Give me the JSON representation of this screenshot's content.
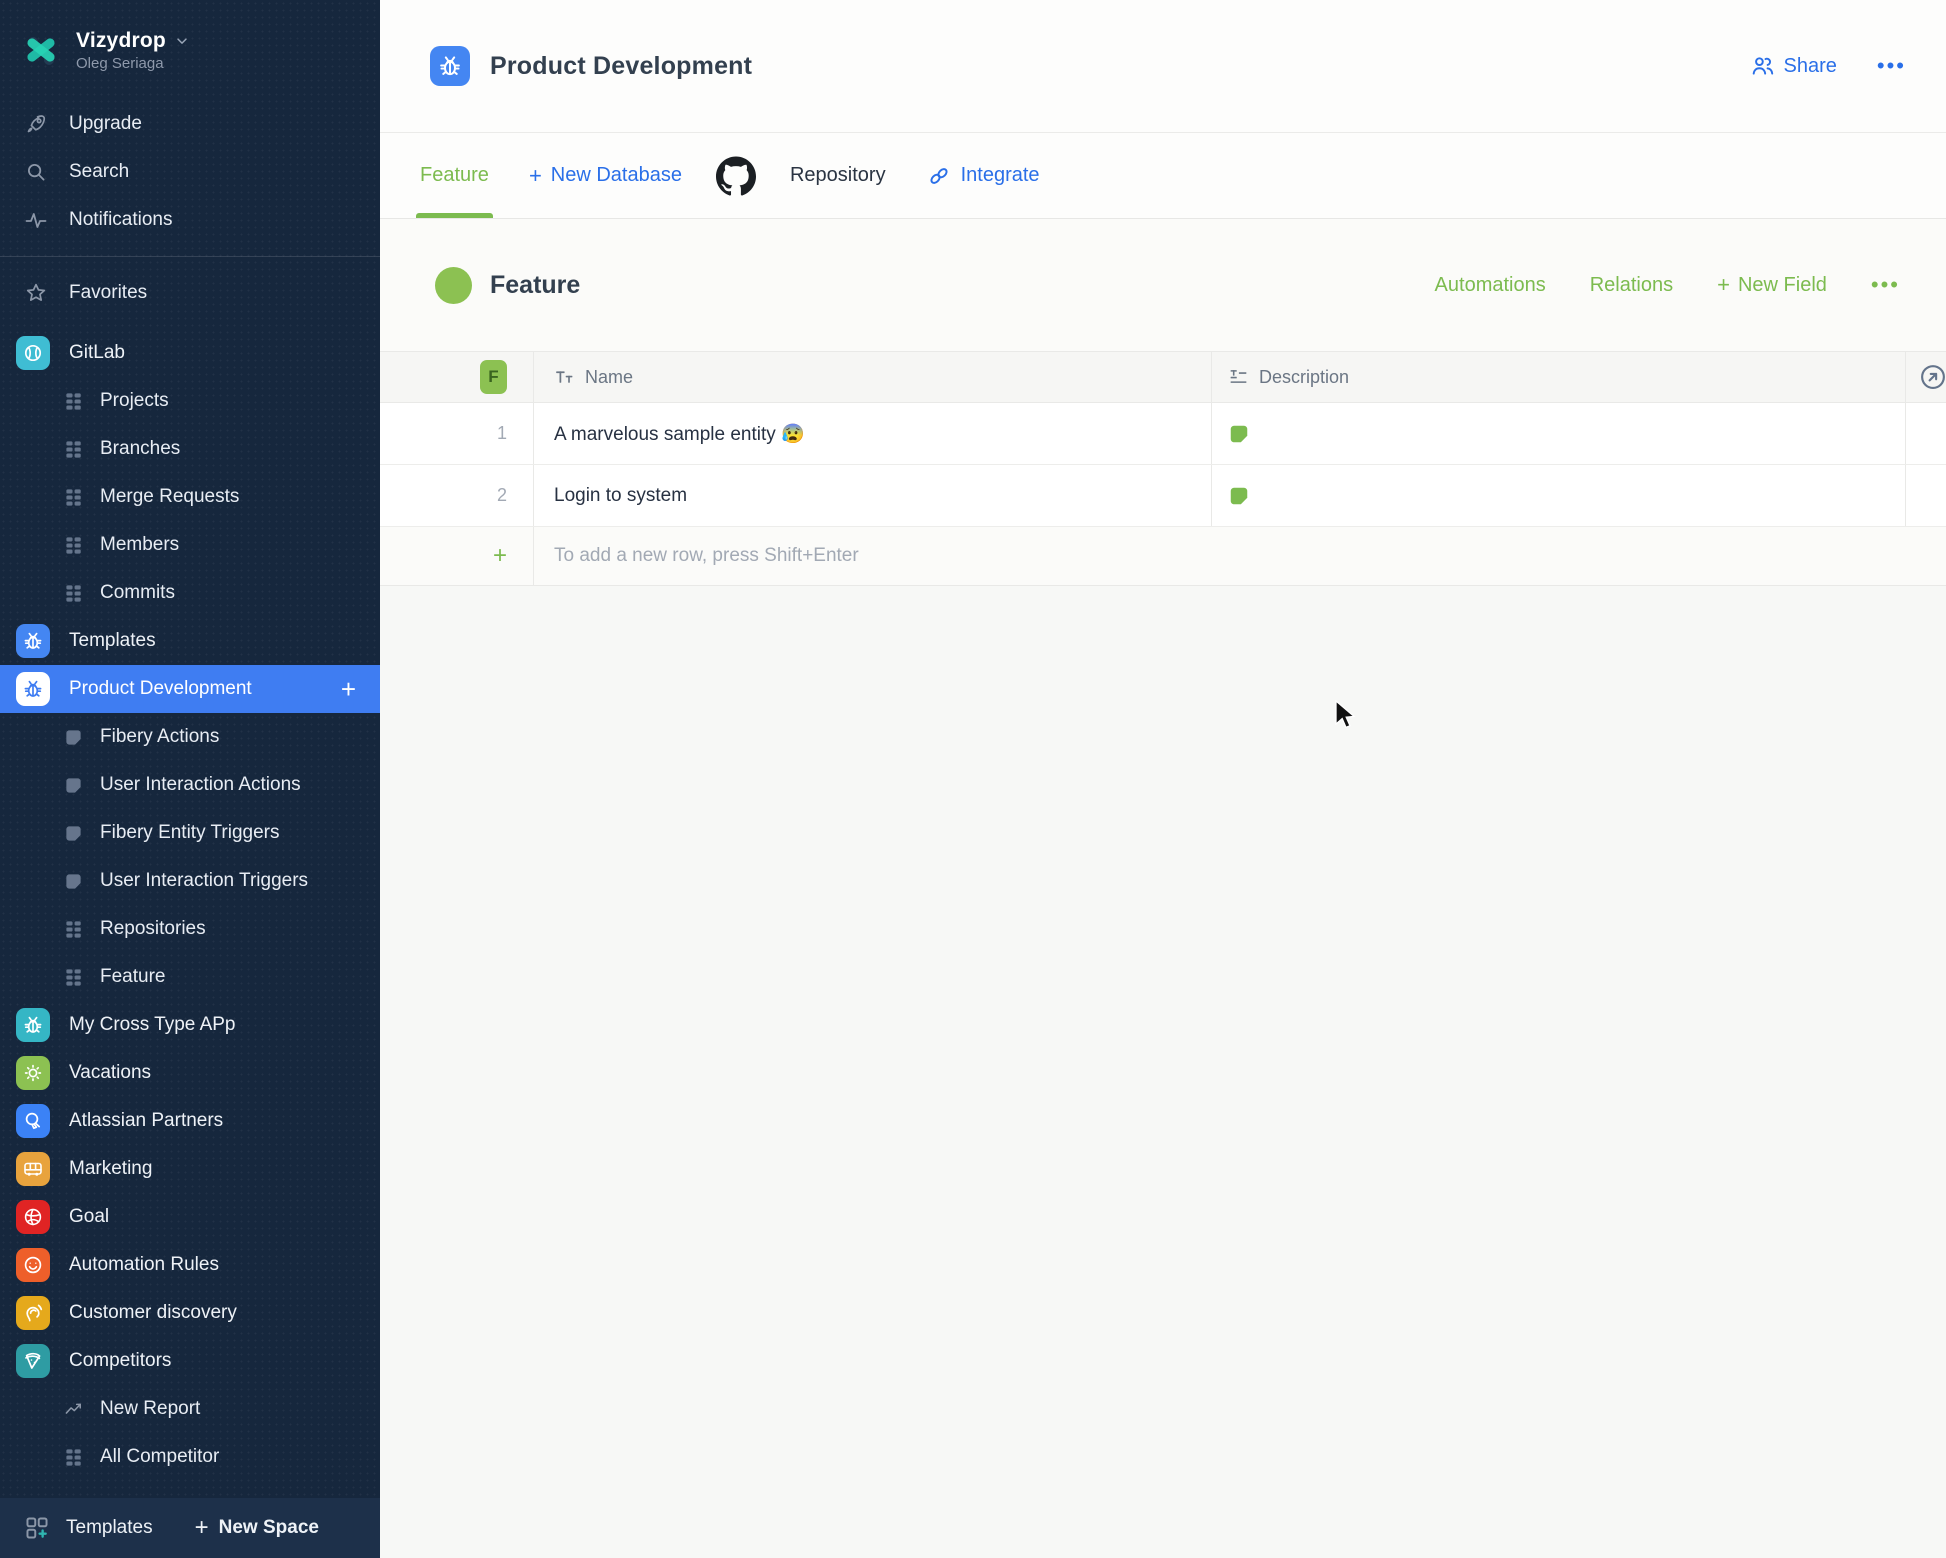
{
  "colors": {
    "sidebar_bg": "#16273d",
    "selected_blue": "#3f7df2",
    "accent_green": "#7cbb4f",
    "accent_blue": "#2a6fe8",
    "tile_blue": "#4486f2",
    "tile_teal": "#35b6c5",
    "tile_green": "#8cc152",
    "tile_amber": "#e8a33d",
    "tile_red": "#e02424",
    "tile_orange": "#ee5f2a",
    "tile_yellow": "#e5a91c",
    "tile_cyan": "#2e9ca3"
  },
  "sidebar": {
    "workspace_name": "Vizydrop",
    "workspace_user": "Oleg Seriaga",
    "upgrade": "Upgrade",
    "search": "Search",
    "notifications": "Notifications",
    "favorites": "Favorites",
    "gitlab": {
      "label": "GitLab",
      "children": [
        "Projects",
        "Branches",
        "Merge Requests",
        "Members",
        "Commits"
      ]
    },
    "templates_space": {
      "label": "Templates"
    },
    "product_development": {
      "label": "Product Development",
      "add_button": "+",
      "doc_children": [
        "Fibery Actions",
        "User Interaction Actions",
        "Fibery Entity Triggers",
        "User Interaction Triggers"
      ],
      "db_children": [
        "Repositories",
        "Feature"
      ]
    },
    "other_spaces": [
      "My Cross Type APp",
      "Vacations",
      "Atlassian Partners",
      "Marketing",
      "Goal",
      "Automation Rules",
      "Customer discovery",
      "Competitors"
    ],
    "competitors_children": [
      "New Report",
      "All Competitor"
    ],
    "bottom_templates": "Templates",
    "bottom_new_space": "New Space"
  },
  "header": {
    "title": "Product Development",
    "share": "Share",
    "more": "•••"
  },
  "tabs": {
    "feature": "Feature",
    "new_database": "New Database",
    "repository": "Repository",
    "integrate": "Integrate"
  },
  "view": {
    "title": "Feature",
    "automations": "Automations",
    "relations": "Relations",
    "new_field": "New Field",
    "more": "•••"
  },
  "table": {
    "type_badge": "F",
    "name_column": "Name",
    "description_column": "Description",
    "rows": [
      {
        "num": "1",
        "name": "A marvelous sample entity 😰"
      },
      {
        "num": "2",
        "name": "Login to system"
      }
    ],
    "add_row_hint": "To add a new row, press Shift+Enter"
  }
}
